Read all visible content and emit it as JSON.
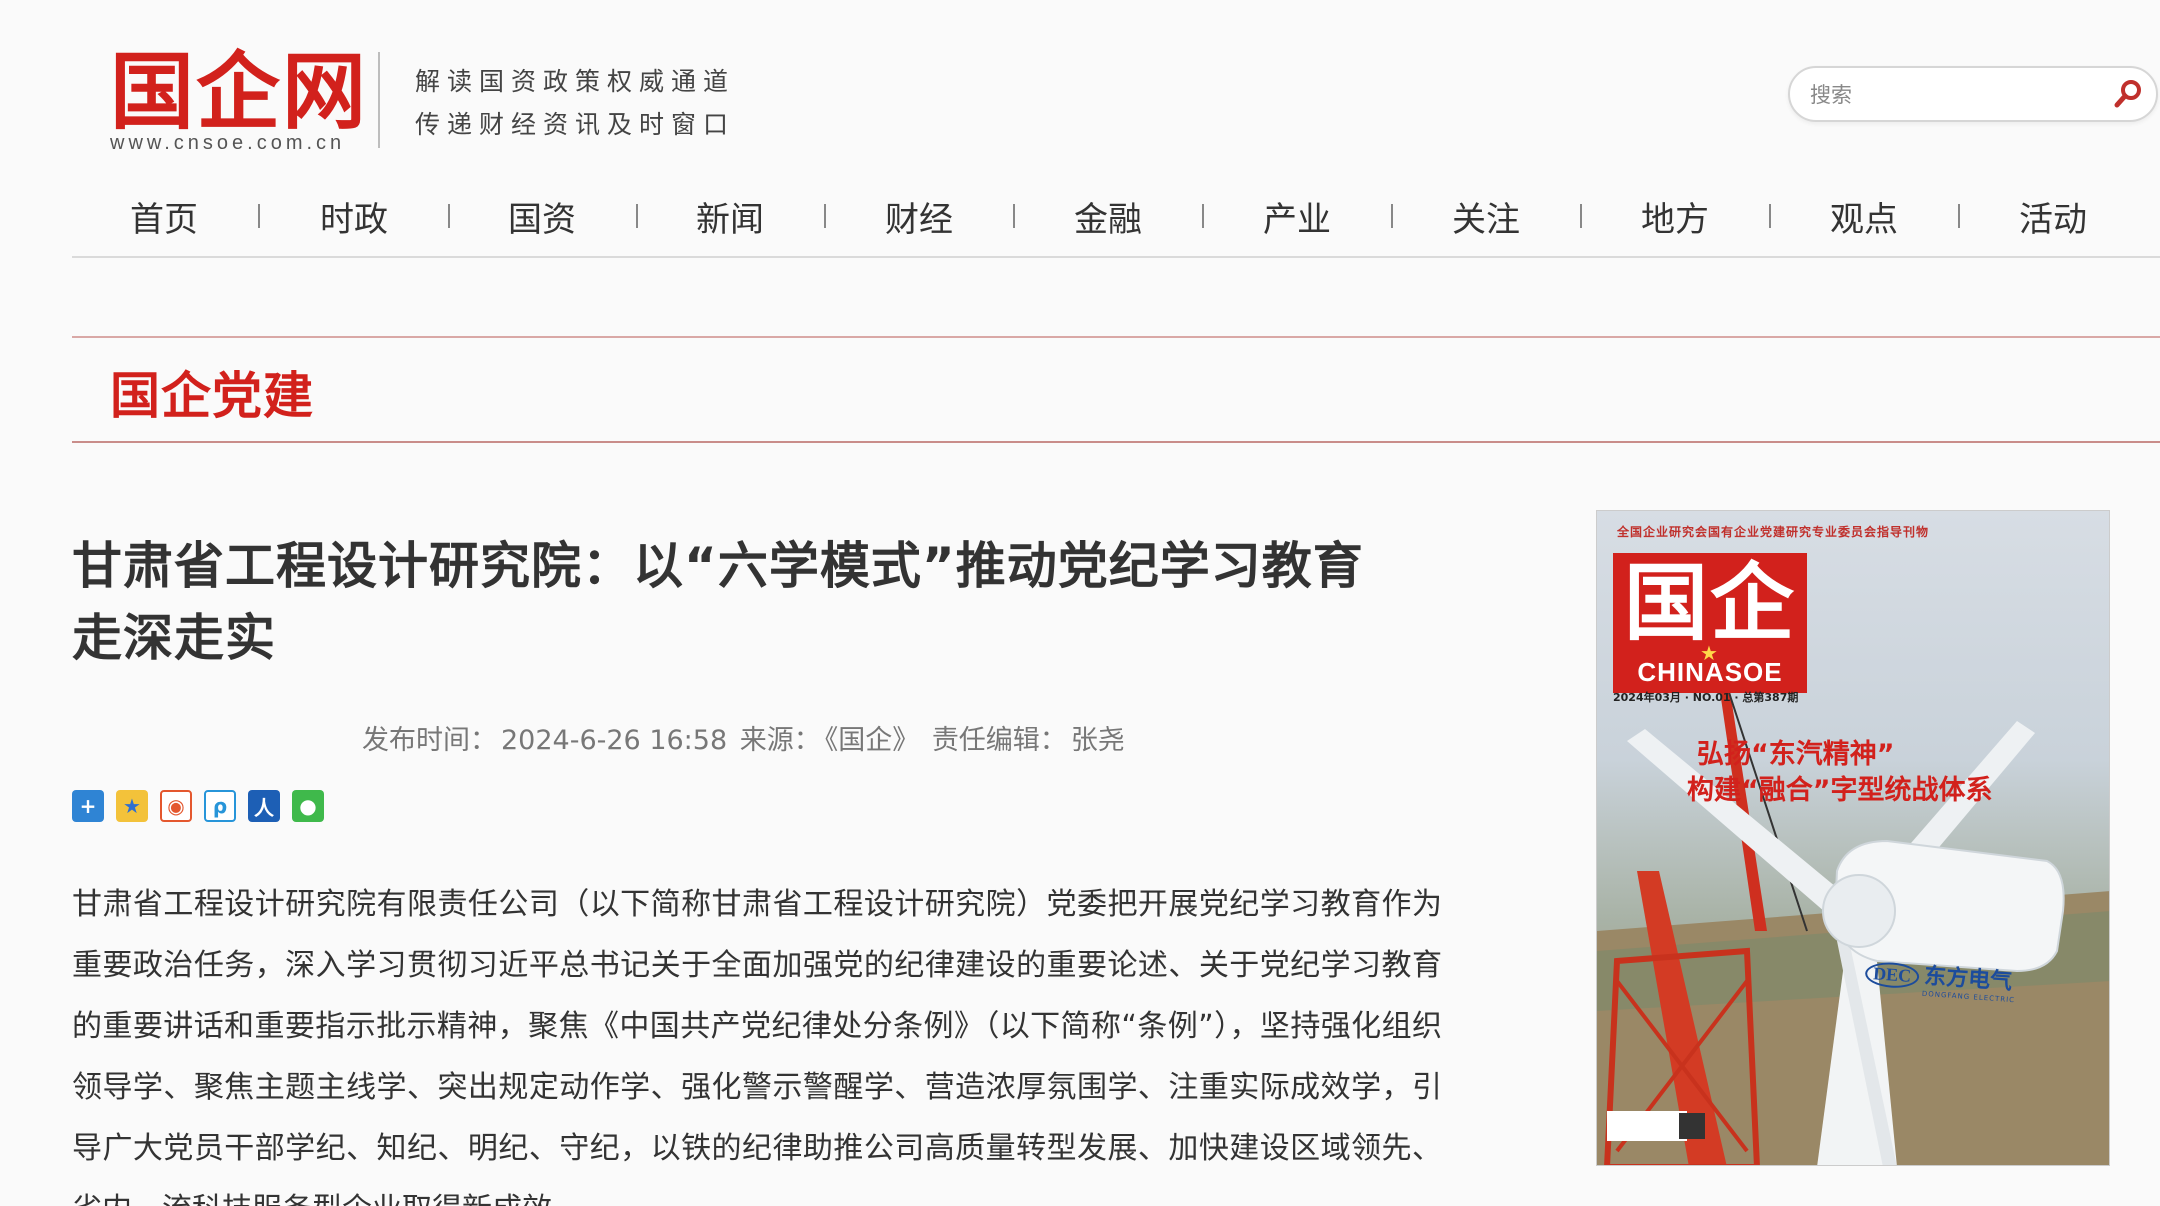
{
  "site": {
    "logo_text": "国企网",
    "url": "www.cnsoe.com.cn",
    "slogan_line1": "解读国资政策权威通道",
    "slogan_line2": "传递财经资讯及时窗口"
  },
  "search": {
    "placeholder": "搜索",
    "value": ""
  },
  "nav": {
    "items": [
      "首页",
      "时政",
      "国资",
      "新闻",
      "财经",
      "金融",
      "产业",
      "关注",
      "地方",
      "观点",
      "活动"
    ]
  },
  "section": {
    "title": "国企党建"
  },
  "article": {
    "title_line1": "甘肃省工程设计研究院：以“六学模式”推动党纪学习教育",
    "title_line2": "走深走实",
    "publish_label": "发布时间：",
    "publish_time": "2024-6-26 16:58",
    "source_label": "来源：",
    "source": "《国企》",
    "editor_label": "责任编辑：",
    "editor": "张尧",
    "body": "甘肃省工程设计研究院有限责任公司（以下简称甘肃省工程设计研究院）党委把开展党纪学习教育作为重要政治任务，深入学习贯彻习近平总书记关于全面加强党的纪律建设的重要论述、关于党纪学习教育的重要讲话和重要指示批示精神，聚焦《中国共产党纪律处分条例》（以下简称“条例”），坚持强化组织领导学、聚焦主题主线学、突出规定动作学、强化警示警醒学、营造浓厚氛围学、注重实际成效学，引导广大党员干部学纪、知纪、明纪、守纪，以铁的纪律助推公司高质量转型发展、加快建设区域领先、省内一流科技服务型企业取得新成效。"
  },
  "share": {
    "icons": [
      "more-share-icon",
      "qzone-icon",
      "weibo-icon",
      "tencent-weibo-icon",
      "renren-icon",
      "wechat-icon"
    ]
  },
  "cover": {
    "top_text": "全国企业研究会国有企业党建研究专业委员会指导刊物",
    "logo_cn": "国企",
    "logo_en": "CHINASOE",
    "issue": "2024年03月 · NO.01 · 总第387期",
    "headline_line1": "弘扬“东汽精神”",
    "headline_line2": "构建“融合”字型统战体系",
    "brand_short": "DEC",
    "brand_cn": "东方电气",
    "brand_en": "DONGFANG ELECTRIC"
  },
  "colors": {
    "brand_red": "#d2211c",
    "text": "#333333",
    "meta": "#777777"
  }
}
